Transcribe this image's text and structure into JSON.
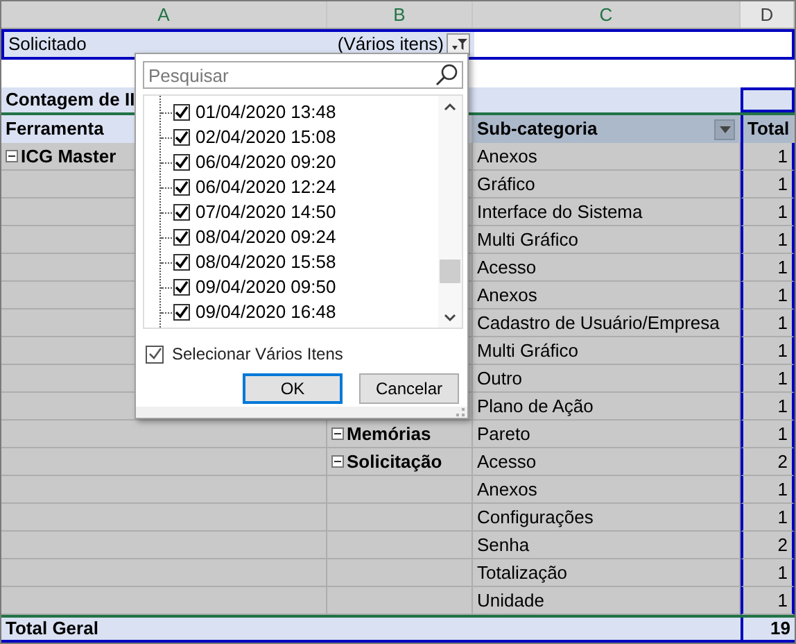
{
  "columns": [
    {
      "letter": "A",
      "selected": true
    },
    {
      "letter": "B",
      "selected": true
    },
    {
      "letter": "C",
      "selected": true
    },
    {
      "letter": "D",
      "selected": false
    }
  ],
  "filter": {
    "label": "Solicitado",
    "value": "(Vários itens)"
  },
  "pivot": {
    "title": "Contagem de II",
    "headers": {
      "column_1": "Ferramenta",
      "column_3": "Sub-categoria",
      "column_4": "Total"
    },
    "rows": [
      {
        "column_1": "ICG Master",
        "expanded": true,
        "column_3": "Anexos",
        "column_4": "1"
      },
      {
        "column_3": "Gráfico",
        "column_4": "1"
      },
      {
        "column_3": "Interface do Sistema",
        "column_4": "1"
      },
      {
        "column_3": "Multi Gráfico",
        "column_4": "1"
      },
      {
        "column_3": "Acesso",
        "column_4": "1"
      },
      {
        "column_3": "Anexos",
        "column_4": "1"
      },
      {
        "column_3": "Cadastro de Usuário/Empresa",
        "column_4": "1"
      },
      {
        "column_3": "Multi Gráfico",
        "column_4": "1"
      },
      {
        "column_3": "Outro",
        "column_4": "1"
      },
      {
        "column_3": "Plano de Ação",
        "column_4": "1"
      },
      {
        "column_2": "Memórias",
        "expanded": true,
        "column_3": "Pareto",
        "column_4": "1"
      },
      {
        "column_2": "Solicitação",
        "expanded": true,
        "column_3": "Acesso",
        "column_4": "2"
      },
      {
        "column_3": "Anexos",
        "column_4": "1"
      },
      {
        "column_3": "Configurações",
        "column_4": "1"
      },
      {
        "column_3": "Senha",
        "column_4": "2"
      },
      {
        "column_3": "Totalização",
        "column_4": "1"
      },
      {
        "column_3": "Unidade",
        "column_4": "1"
      }
    ],
    "total_row": {
      "label": "Total Geral",
      "total": "19"
    }
  },
  "dropdown": {
    "search_placeholder": "Pesquisar",
    "items": [
      {
        "label": "01/04/2020 13:48",
        "checked": true
      },
      {
        "label": "02/04/2020 15:08",
        "checked": true
      },
      {
        "label": "06/04/2020 09:20",
        "checked": true
      },
      {
        "label": "06/04/2020 12:24",
        "checked": true
      },
      {
        "label": "07/04/2020 14:50",
        "checked": true
      },
      {
        "label": "08/04/2020 09:24",
        "checked": true
      },
      {
        "label": "08/04/2020 15:58",
        "checked": true
      },
      {
        "label": "09/04/2020 09:50",
        "checked": true
      },
      {
        "label": "09/04/2020 16:48",
        "checked": true
      }
    ],
    "multi_select": {
      "label": "Selecionar Vários Itens",
      "checked": true
    },
    "buttons": [
      {
        "label": "OK",
        "default": true
      },
      {
        "label": "Cancelar",
        "default": false
      }
    ]
  }
}
